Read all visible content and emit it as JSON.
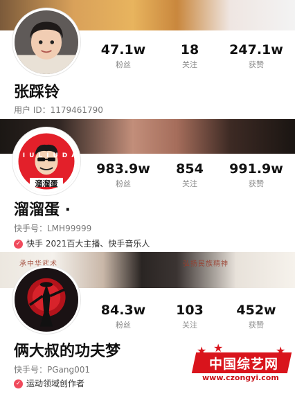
{
  "profiles": [
    {
      "name": "张踩铃",
      "id_line": "用户 ID：1179461790",
      "stats": [
        {
          "value": "47.1w",
          "label": "粉丝"
        },
        {
          "value": "18",
          "label": "关注"
        },
        {
          "value": "247.1w",
          "label": "获赞"
        }
      ]
    },
    {
      "name": "溜溜蛋 ·",
      "id_line": "快手号：LMH99999",
      "badge": "快手 2021百大主播、快手音乐人",
      "avatar_text_top": "LIULIUDAN",
      "avatar_text_bottom": "溜溜蛋",
      "stats": [
        {
          "value": "983.9w",
          "label": "粉丝"
        },
        {
          "value": "854",
          "label": "关注"
        },
        {
          "value": "991.9w",
          "label": "获赞"
        }
      ]
    },
    {
      "name": "俩大叔的功夫梦",
      "id_line": "快手号：PGang001",
      "badge": "运动领域创作者",
      "banner_text_left": "承中华武术",
      "banner_text_right": "弘扬民族精神",
      "stats": [
        {
          "value": "84.3w",
          "label": "粉丝"
        },
        {
          "value": "103",
          "label": "关注"
        },
        {
          "value": "452w",
          "label": "获赞"
        }
      ]
    }
  ],
  "watermark": {
    "title": "中国综艺网",
    "url": "www.czongyi.com"
  },
  "colors": {
    "badge": "#f04a5c",
    "watermark_red": "#d9141c"
  }
}
